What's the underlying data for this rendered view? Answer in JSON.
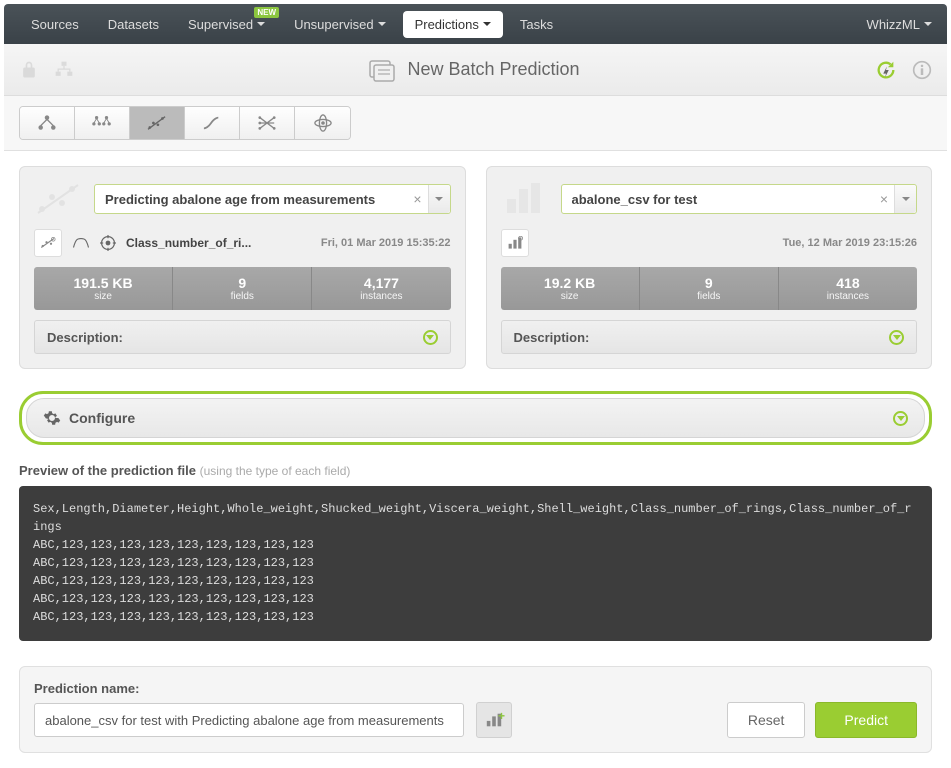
{
  "nav": {
    "sources": "Sources",
    "datasets": "Datasets",
    "supervised": "Supervised",
    "unsupervised": "Unsupervised",
    "predictions": "Predictions",
    "tasks": "Tasks",
    "whizzml": "WhizzML",
    "new_badge": "NEW"
  },
  "header": {
    "title": "New Batch Prediction"
  },
  "model_panel": {
    "input_value": "Predicting abalone age from measurements",
    "objective": "Class_number_of_ri...",
    "timestamp": "Fri, 01 Mar 2019 15:35:22",
    "stats": {
      "size_val": "191.5 KB",
      "size_lbl": "size",
      "fields_val": "9",
      "fields_lbl": "fields",
      "instances_val": "4,177",
      "instances_lbl": "instances"
    },
    "description": "Description:"
  },
  "dataset_panel": {
    "input_value": "abalone_csv for test",
    "timestamp": "Tue, 12 Mar 2019 23:15:26",
    "stats": {
      "size_val": "19.2 KB",
      "size_lbl": "size",
      "fields_val": "9",
      "fields_lbl": "fields",
      "instances_val": "418",
      "instances_lbl": "instances"
    },
    "description": "Description:"
  },
  "configure": {
    "label": "Configure"
  },
  "preview": {
    "title": "Preview of the prediction file",
    "subtitle": "(using the type of each field)",
    "content": "Sex,Length,Diameter,Height,Whole_weight,Shucked_weight,Viscera_weight,Shell_weight,Class_number_of_rings,Class_number_of_rings\nABC,123,123,123,123,123,123,123,123,123\nABC,123,123,123,123,123,123,123,123,123\nABC,123,123,123,123,123,123,123,123,123\nABC,123,123,123,123,123,123,123,123,123\nABC,123,123,123,123,123,123,123,123,123"
  },
  "footer": {
    "name_label": "Prediction name:",
    "name_value": "abalone_csv for test with Predicting abalone age from measurements",
    "reset": "Reset",
    "predict": "Predict"
  }
}
